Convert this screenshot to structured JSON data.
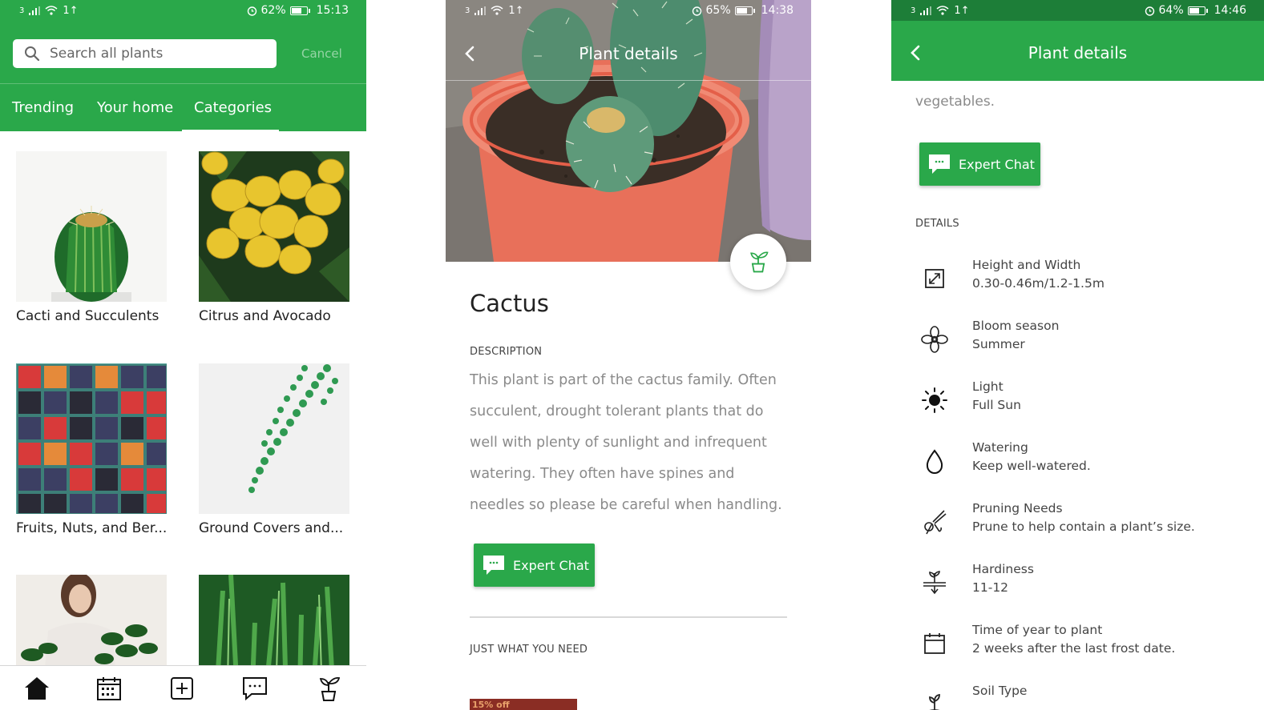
{
  "colors": {
    "brand_green": "#2aa84a",
    "status_dark_green": "#1d7e38"
  },
  "screen1": {
    "status": {
      "carrier": "3",
      "data": "1↑",
      "battery": "62%",
      "battery_level": 0.62,
      "time": "15:13"
    },
    "search": {
      "placeholder": "Search all plants",
      "icon": "search-icon"
    },
    "cancel": "Cancel",
    "tabs": [
      {
        "label": "Trending"
      },
      {
        "label": "Your home"
      },
      {
        "label": "Categories"
      }
    ],
    "active_tab": "Categories",
    "categories": [
      {
        "label": "Cacti and Succulents"
      },
      {
        "label": "Citrus and Avocado"
      },
      {
        "label": "Fruits, Nuts, and Ber..."
      },
      {
        "label": "Ground Covers and..."
      }
    ],
    "bottom_nav": [
      "home-icon",
      "calendar-icon",
      "add-icon",
      "chat-icon",
      "plant-icon"
    ]
  },
  "screen2": {
    "status": {
      "carrier": "3",
      "data": "1↑",
      "battery": "65%",
      "battery_level": 0.65,
      "time": "14:38"
    },
    "title": "Plant details",
    "plant_name": "Cactus",
    "description_label": "DESCRIPTION",
    "description": "This plant is part of the cactus family.  Often succulent, drought tolerant plants that do well with plenty of sunlight and infrequent watering.  They often have spines and needles so please be careful when handling.",
    "expert_chat": "Expert Chat",
    "section_label": "JUST WHAT YOU NEED",
    "promo_text": "15% off"
  },
  "screen3": {
    "status": {
      "carrier": "3",
      "data": "1↑",
      "battery": "64%",
      "battery_level": 0.64,
      "time": "14:46"
    },
    "title": "Plant details",
    "leading_text": "vegetables.",
    "expert_chat": "Expert Chat",
    "details_label": "DETAILS",
    "details": [
      {
        "icon": "resize-icon",
        "title": "Height and Width",
        "value": "0.30-0.46m/1.2-1.5m"
      },
      {
        "icon": "flower-icon",
        "title": "Bloom season",
        "value": "Summer"
      },
      {
        "icon": "sun-icon",
        "title": "Light",
        "value": "Full Sun"
      },
      {
        "icon": "water-drop-icon",
        "title": "Watering",
        "value": "Keep well-watered."
      },
      {
        "icon": "pruning-shears-icon",
        "title": "Pruning Needs",
        "value": "Prune to help contain a plant’s size."
      },
      {
        "icon": "hardiness-icon",
        "title": "Hardiness",
        "value": "11-12"
      },
      {
        "icon": "calendar-icon",
        "title": "Time of year to plant",
        "value": "2 weeks after the last frost date."
      },
      {
        "icon": "soil-icon",
        "title": "Soil Type",
        "value": ""
      }
    ]
  }
}
